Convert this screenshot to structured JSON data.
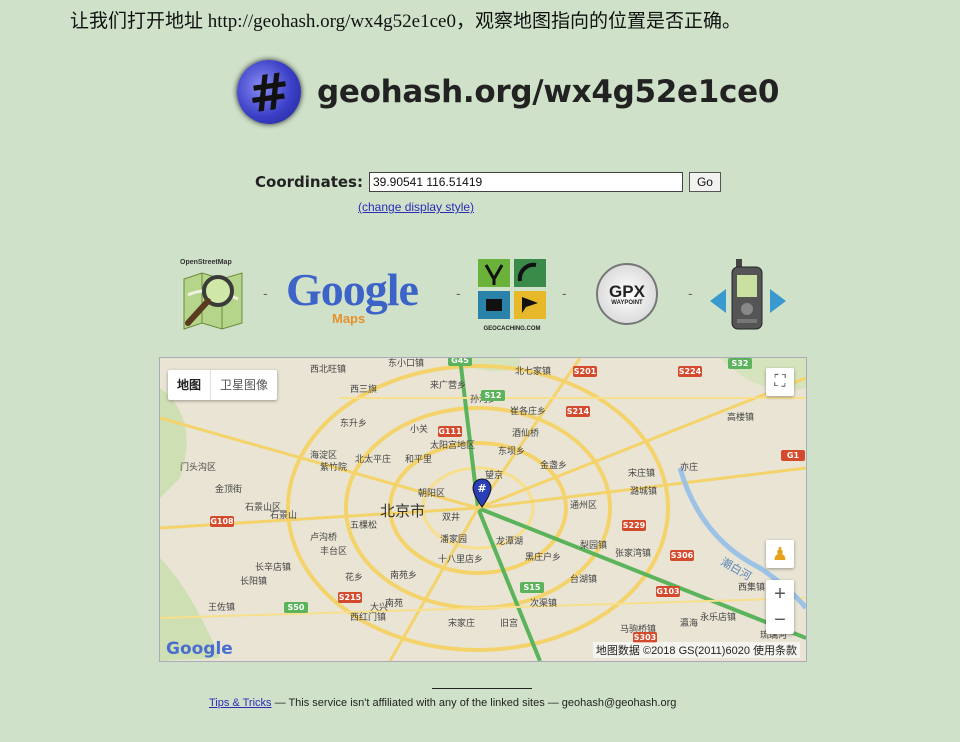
{
  "intro_text": "让我们打开地址 http://geohash.org/wx4g52e1ce0，观察地图指向的位置是否正确。",
  "header": {
    "site_title": "geohash.org/wx4g52e1ce0",
    "logo_glyph": "#"
  },
  "coordinates": {
    "label": "Coordinates:",
    "value": "39.90541 116.51419",
    "go_label": "Go",
    "change_link": "(change display style)"
  },
  "services": [
    {
      "name": "OpenStreetMap",
      "icon": "osm-magnifier-icon"
    },
    {
      "name": "Google",
      "sub": "Maps",
      "icon": "google-maps-logo"
    },
    {
      "name": "GEOCACHING.COM",
      "icon": "geocaching-icon"
    },
    {
      "name": "GPX",
      "sub": "WAYPOINT",
      "icon": "gpx-waypoint-icon"
    },
    {
      "name": "",
      "icon": "gps-device-icon"
    }
  ],
  "separator": "-",
  "map": {
    "tab_map": "地图",
    "tab_satellite": "卫星图像",
    "center_label": "北京市",
    "labels": [
      "东小口镇",
      "西北旺镇",
      "西三旗",
      "北七家镇",
      "东升乡",
      "小关",
      "太阳宫地区",
      "望京",
      "金盏乡",
      "黑庄户乡",
      "通州区",
      "朝阳区",
      "双井",
      "潘家园",
      "南苑乡",
      "十八里店乡",
      "大兴",
      "台湖镇",
      "张家湾镇",
      "西集镇",
      "永乐店镇",
      "宋庄镇",
      "潞城镇",
      "梨园镇",
      "马驹桥镇",
      "长辛店镇",
      "卢沟桥",
      "丰台区",
      "石景山区",
      "金顶街",
      "海淀区",
      "紫竹院",
      "北太平庄",
      "和平里",
      "东坝乡",
      "孙河乡",
      "崔各庄乡",
      "来广营乡",
      "高楼镇",
      "亦庄",
      "花乡",
      "南苑",
      "次渠镇",
      "旧宫",
      "瀛海",
      "长阳镇",
      "王佐镇",
      "西红门镇",
      "宋家庄",
      "酒仙桥",
      "龙潭湖",
      "门头沟区",
      "石景山",
      "五棵松",
      "琉璃河"
    ],
    "roads": [
      "G45",
      "S32",
      "S224",
      "S201",
      "S12",
      "S214",
      "G111",
      "G1",
      "G108",
      "S229",
      "S306",
      "S215",
      "S15",
      "S50",
      "G103",
      "S303"
    ],
    "river_label": "潮白河",
    "attribution": "地图数据 ©2018 GS(2011)6020   使用条款",
    "google_logo": "Google",
    "pin_glyph": "#"
  },
  "footer": {
    "tips_link": "Tips & Tricks",
    "disclaimer": " — This service isn't affiliated with any of the linked sites — geohash@geohash.org"
  },
  "colors": {
    "page_bg": "#cfe2c9",
    "link": "#2c2cb8",
    "map_bg": "#e6e1d1",
    "road_yellow": "#f4d36b",
    "road_green": "#5bb35b",
    "road_red": "#d44a2d"
  }
}
